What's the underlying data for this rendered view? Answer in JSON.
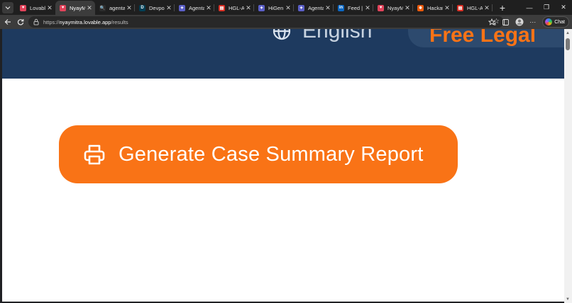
{
  "browser": {
    "tabs": [
      {
        "title": "Lovable",
        "favicon_color": "#e0435a",
        "favicon_glyph": "♥"
      },
      {
        "title": "NyayMitr",
        "favicon_color": "#e0435a",
        "favicon_glyph": "♥"
      },
      {
        "title": "agentath",
        "favicon_color": "#2b2b2b",
        "favicon_glyph": "🔍"
      },
      {
        "title": "Devpost",
        "favicon_color": "#003e54",
        "favicon_glyph": "D"
      },
      {
        "title": "Agentath",
        "favicon_color": "#5b5fc7",
        "favicon_glyph": "✦"
      },
      {
        "title": "HGL-AG",
        "favicon_color": "#d93025",
        "favicon_glyph": "▤"
      },
      {
        "title": "HiGen Lin",
        "favicon_color": "#5b5fc7",
        "favicon_glyph": "✦"
      },
      {
        "title": "Agentath",
        "favicon_color": "#5b5fc7",
        "favicon_glyph": "✦"
      },
      {
        "title": "Feed | Lin",
        "favicon_color": "#0a66c2",
        "favicon_glyph": "in"
      },
      {
        "title": "NyayMitr",
        "favicon_color": "#e0435a",
        "favicon_glyph": "♥"
      },
      {
        "title": "Hackatho",
        "favicon_color": "#e8590c",
        "favicon_glyph": "✸"
      },
      {
        "title": "HGL-AG",
        "favicon_color": "#d93025",
        "favicon_glyph": "▤"
      }
    ],
    "active_tab_index": 1,
    "url_prefix": "https://",
    "url_host": "nyaymitra.lovable.app",
    "url_path": "/results",
    "chat_label": "Chat"
  },
  "page": {
    "language_label": "English",
    "free_pill_label": "Free Legal",
    "generate_button_label": "Generate Case Summary Report"
  },
  "colors": {
    "hero_bg": "#1e3a5f",
    "accent_orange": "#f97316"
  }
}
